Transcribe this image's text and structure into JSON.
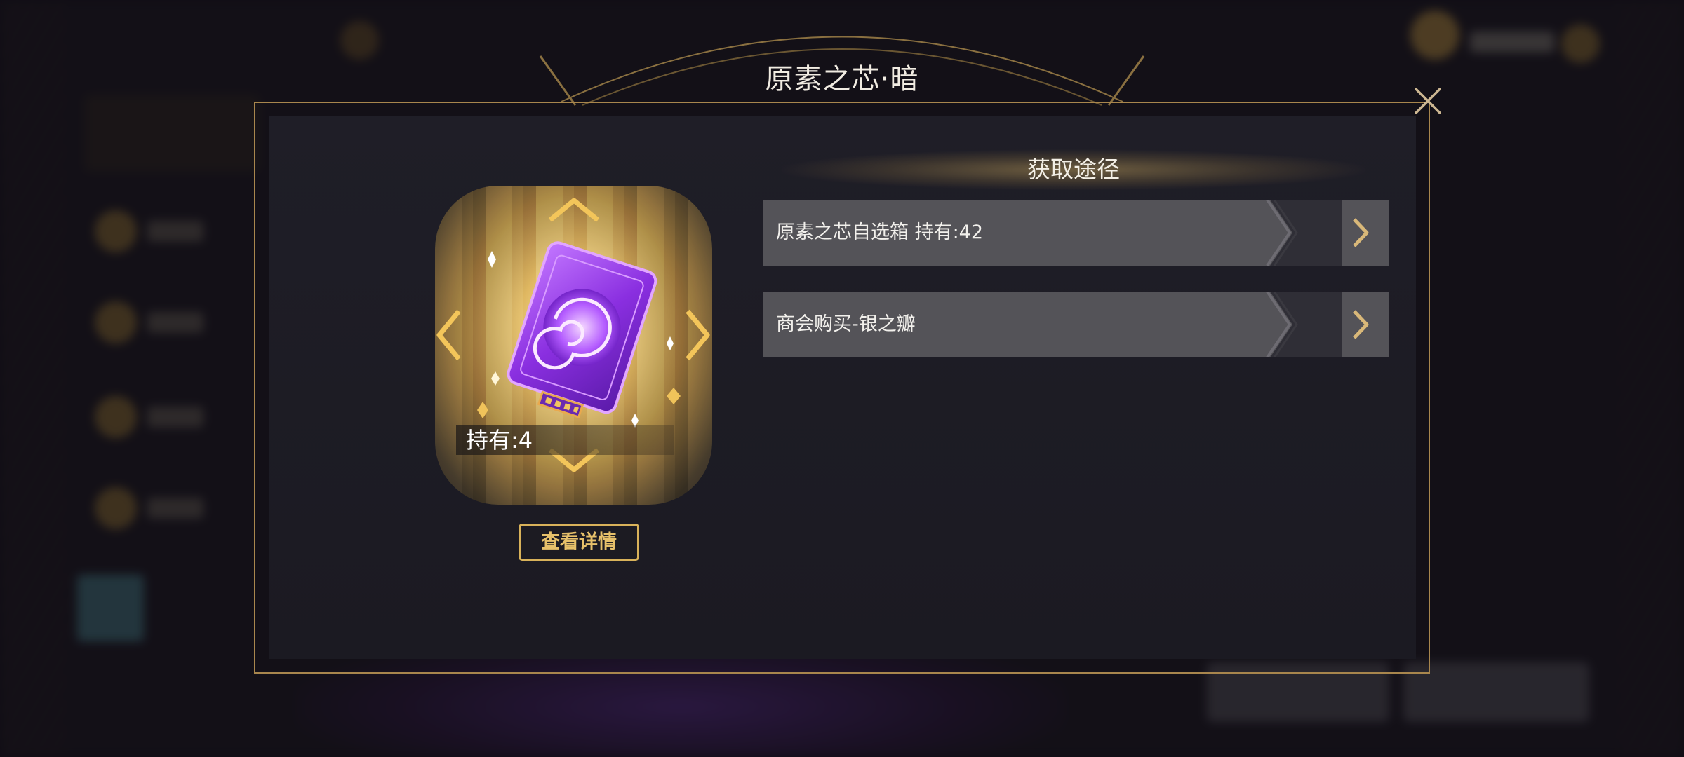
{
  "dialog": {
    "title": "原素之芯·暗",
    "close_icon": "close-icon"
  },
  "item": {
    "hold_label": "持有:4",
    "detail_button": "查看详情",
    "icon": "dark-element-core-icon",
    "nav_icons": [
      "chevron-up-icon",
      "chevron-down-icon",
      "chevron-left-icon",
      "chevron-right-icon"
    ]
  },
  "sources": {
    "title": "获取途径",
    "items": [
      {
        "label": "原素之芯自选箱 持有:42"
      },
      {
        "label": "商会购买-银之瓣"
      }
    ]
  },
  "colors": {
    "gold": "#d8b25a",
    "frame": "#a8864d",
    "row": "#545358",
    "panel": "#1f1e27",
    "purple": "#9b3ee0"
  }
}
